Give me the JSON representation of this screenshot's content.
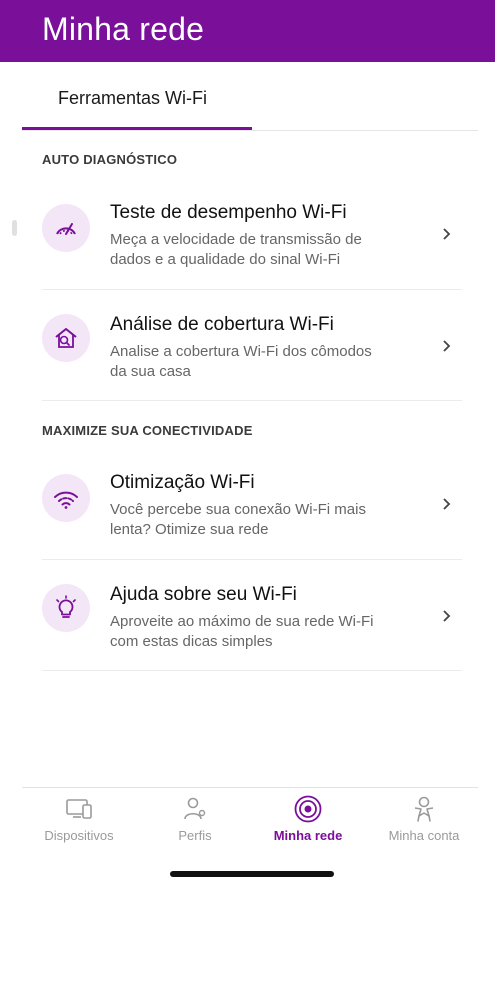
{
  "header": {
    "title": "Minha rede"
  },
  "tabs": [
    {
      "label": "Ferramentas Wi-Fi"
    }
  ],
  "sections": [
    {
      "title": "AUTO DIAGNÓSTICO",
      "items": [
        {
          "title": "Teste de desempenho Wi-Fi",
          "desc_line1": "Meça a velocidade de transmissão de",
          "desc_line2": "dados e a qualidade do sinal Wi-Fi",
          "icon": "speedometer-icon"
        },
        {
          "title": "Análise de cobertura Wi-Fi",
          "desc_line1": "Analise a cobertura Wi-Fi dos cômodos",
          "desc_line2": "da sua casa",
          "icon": "house-search-icon"
        }
      ]
    },
    {
      "title": "MAXIMIZE SUA CONECTIVIDADE",
      "items": [
        {
          "title": "Otimização Wi-Fi",
          "desc_line1": "Você percebe sua conexão Wi-Fi mais",
          "desc_line2": "lenta? Otimize sua rede",
          "icon": "wifi-icon"
        },
        {
          "title": "Ajuda sobre seu Wi-Fi",
          "desc_line1": "Aproveite ao máximo de sua rede Wi-Fi",
          "desc_line2": "com estas dicas simples",
          "icon": "lightbulb-icon"
        }
      ]
    }
  ],
  "bottom_nav": [
    {
      "label": "Dispositivos",
      "icon": "devices-icon",
      "active": false
    },
    {
      "label": "Perfis",
      "icon": "profiles-icon",
      "active": false
    },
    {
      "label": "Minha rede",
      "icon": "network-icon",
      "active": true
    },
    {
      "label": "Minha conta",
      "icon": "account-icon",
      "active": false
    }
  ],
  "colors": {
    "brand": "#7a0f9a",
    "icon_bg": "#f3e6f7",
    "inactive": "#9a9a9a"
  }
}
